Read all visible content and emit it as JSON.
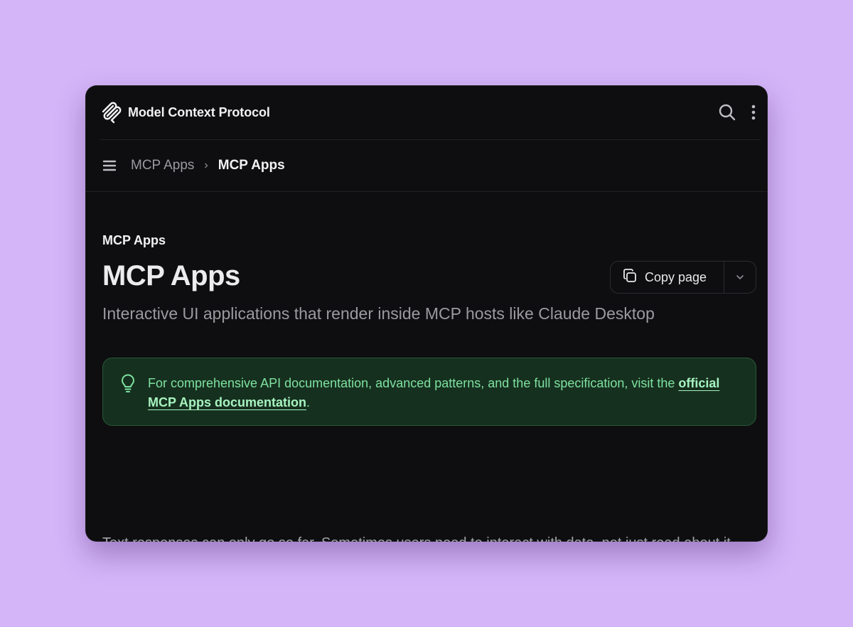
{
  "header": {
    "brand": "Model Context Protocol"
  },
  "breadcrumb": {
    "parent": "MCP Apps",
    "separator": "›",
    "current": "MCP Apps"
  },
  "page": {
    "eyebrow": "MCP Apps",
    "title": "MCP Apps",
    "subtitle": "Interactive UI applications that render inside MCP hosts like Claude Desktop",
    "copy_button_label": "Copy page",
    "callout": {
      "text": "For comprehensive API documentation, advanced patterns, and the full specification, visit the ",
      "link_text": "official MCP Apps documentation",
      "trailing": "."
    },
    "body": "Text responses can only go so far. Sometimes users need to interact with data, not just read about it. MCP Apps let servers return interactive HTML interfaces (data visualizations, forms, dashboards) that render directly in the chat."
  },
  "icons": {
    "logo": "mcp-logo-icon",
    "search": "search-icon",
    "more": "more-vertical-icon",
    "menu": "hamburger-menu-icon",
    "copy": "copy-icon",
    "dropdown": "chevron-down-icon",
    "callout": "lightbulb-icon"
  },
  "colors": {
    "page_background": "#d4b5f8",
    "window_background": "#0e0e10",
    "callout_background": "#16301f",
    "callout_text": "#7ee2a0"
  }
}
